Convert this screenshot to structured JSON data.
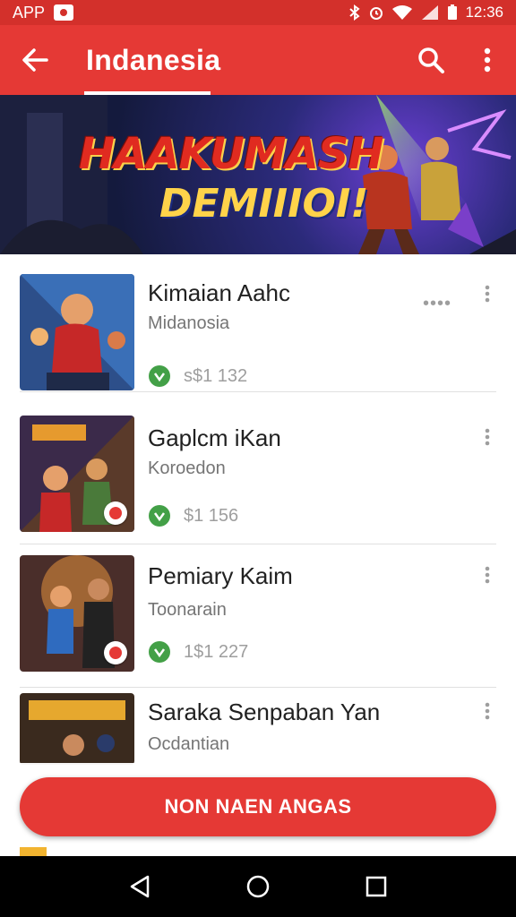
{
  "status_bar": {
    "app_label": "APP",
    "time": "12:36"
  },
  "app_bar": {
    "title": "Indanesia"
  },
  "banner": {
    "title": "HAAKUMASH",
    "subtitle": "DEMIIIOI!"
  },
  "items": [
    {
      "title": "Kimaian Aahc",
      "subtitle": "Midanosia",
      "stat": "s$1 132",
      "dots": "••••"
    },
    {
      "title": "Gaplcm iKan",
      "subtitle": "Koroedon",
      "stat": "$1 156",
      "dots": ""
    },
    {
      "title": "Pemiary Kaim",
      "subtitle": "Toonarain",
      "stat": "1$1 227",
      "dots": ""
    },
    {
      "title": "Saraka Senpaban Yan",
      "subtitle": "Ocdantian",
      "stat": "",
      "dots": ""
    }
  ],
  "action_button": {
    "label": "NON NAEN ANGAS"
  },
  "colors": {
    "primary": "#e53935",
    "status_bar": "#d3302b",
    "rating_green": "#43a047"
  }
}
